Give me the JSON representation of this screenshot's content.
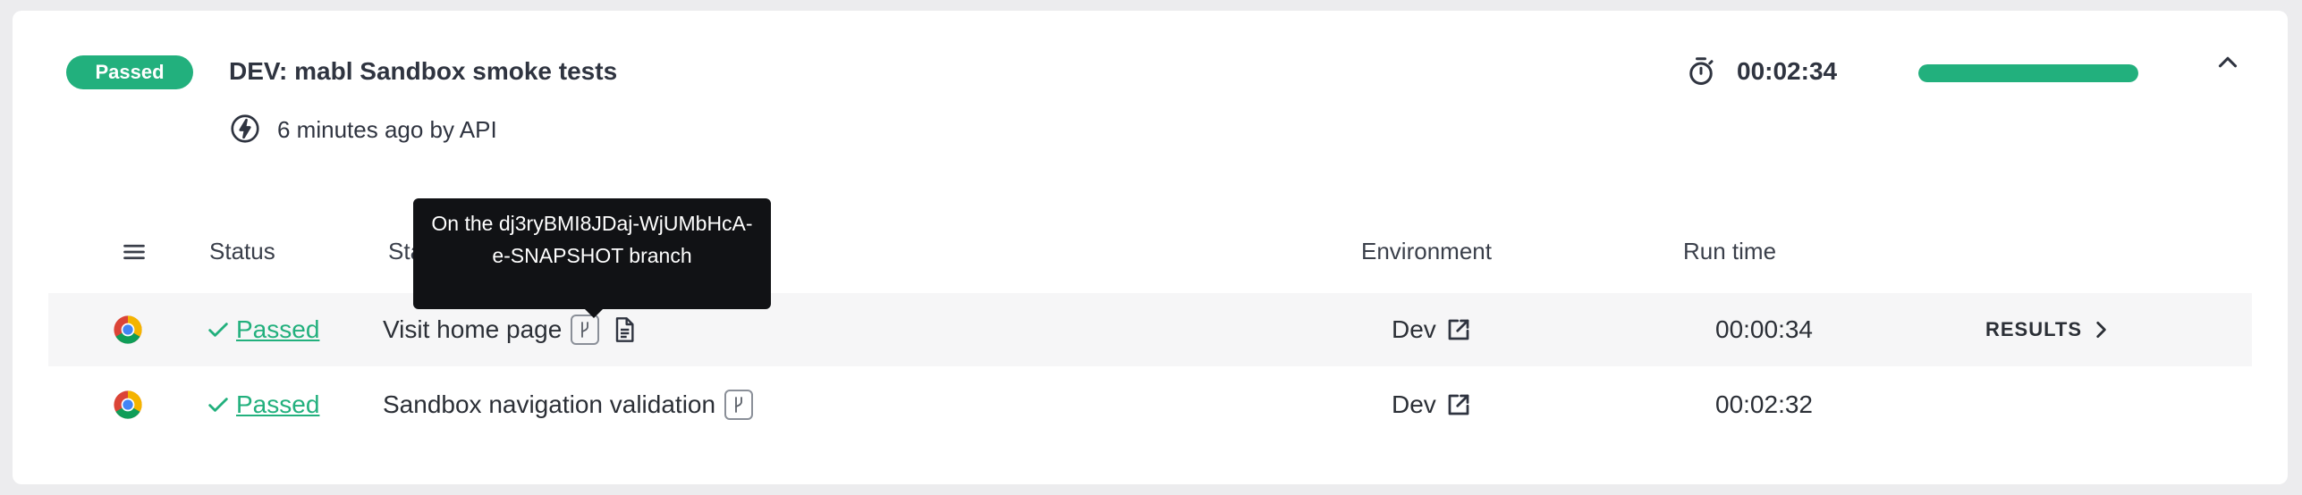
{
  "plan": {
    "status": "Passed",
    "title": "DEV: mabl Sandbox smoke tests",
    "duration": "00:02:34",
    "progress": 1.0,
    "trigger": "6 minutes ago by API"
  },
  "table": {
    "headers": {
      "status": "Status",
      "stage": "Stage",
      "environment": "Environment",
      "run_time": "Run time"
    },
    "rows": [
      {
        "browser_icon": "chrome-icon",
        "status": "Passed",
        "name": "Visit home page",
        "environment": "Dev",
        "run_time": "00:00:34",
        "action": "RESULTS"
      },
      {
        "browser_icon": "chrome-icon",
        "status": "Passed",
        "name": "Sandbox navigation validation",
        "environment": "Dev",
        "run_time": "00:02:32",
        "action": ""
      }
    ]
  },
  "tooltip": {
    "text": "On the dj3ryBMI8JDaj-WjUMbHcA-e-SNAPSHOT branch"
  },
  "colors": {
    "success": "#22b07d",
    "tooltip_bg": "#111215"
  }
}
